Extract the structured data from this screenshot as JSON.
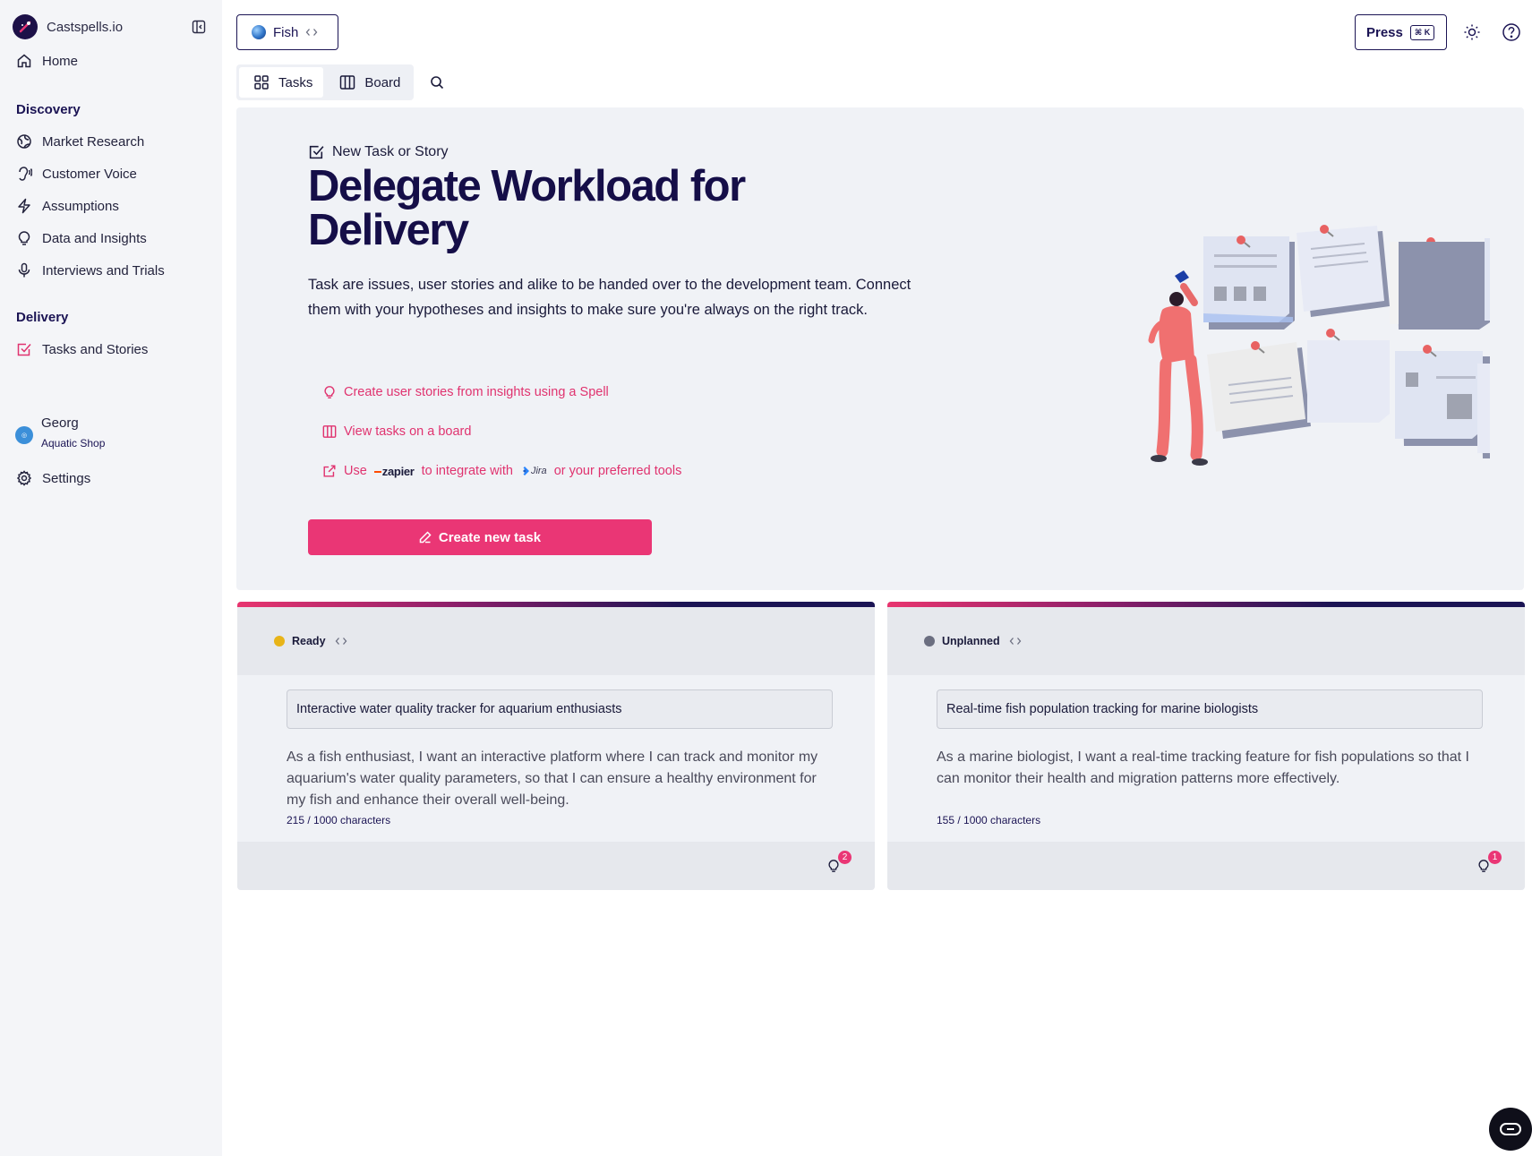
{
  "app": {
    "name": "Castspells.io"
  },
  "sidebar": {
    "home": "Home",
    "sections": [
      {
        "title": "Discovery",
        "items": [
          "Market Research",
          "Customer Voice",
          "Assumptions",
          "Data and Insights",
          "Interviews and Trials"
        ]
      },
      {
        "title": "Delivery",
        "items": [
          "Tasks and Stories"
        ]
      }
    ],
    "user": {
      "name": "Georg",
      "org": "Aquatic Shop"
    },
    "settings": "Settings"
  },
  "topbar": {
    "project": "Fish",
    "press_label": "Press",
    "shortcut": "⌘ K"
  },
  "tabs": [
    {
      "label": "Tasks",
      "active": true
    },
    {
      "label": "Board",
      "active": false
    }
  ],
  "hero": {
    "eyebrow": "New Task or Story",
    "title": "Delegate Workload for Delivery",
    "description": "Task are issues, user stories and alike to be handed over to the development team. Connect them with your hypotheses and insights to make sure you're always on the right track.",
    "links": {
      "spell": "Create user stories from insights using a Spell",
      "board": "View tasks on a board",
      "use": "Use",
      "zapier": "zapier",
      "integrate": "to integrate with",
      "jira": "Jira",
      "tools": "or your preferred tools"
    },
    "cta": "Create new task"
  },
  "columns": [
    {
      "status": "Ready",
      "status_color": "#e8b418",
      "task_title": "Interactive water quality tracker for aquarium enthusiasts",
      "task_body": "As a fish enthusiast, I want an interactive platform where I can track and monitor my aquarium's water quality parameters, so that I can ensure a healthy environment for my fish and enhance their overall well-being.",
      "char_count": "215 / 1000 characters",
      "insight_count": "2"
    },
    {
      "status": "Unplanned",
      "status_color": "#6b6e80",
      "task_title": "Real-time fish population tracking for marine biologists",
      "task_body": "As a marine biologist, I want a real-time tracking feature for fish populations so that I can monitor their health and migration patterns more effectively.",
      "char_count": "155 / 1000 characters",
      "insight_count": "1"
    }
  ],
  "colors": {
    "accent": "#ea3675",
    "navy": "#1b1454",
    "panel": "#f0f2f6"
  }
}
